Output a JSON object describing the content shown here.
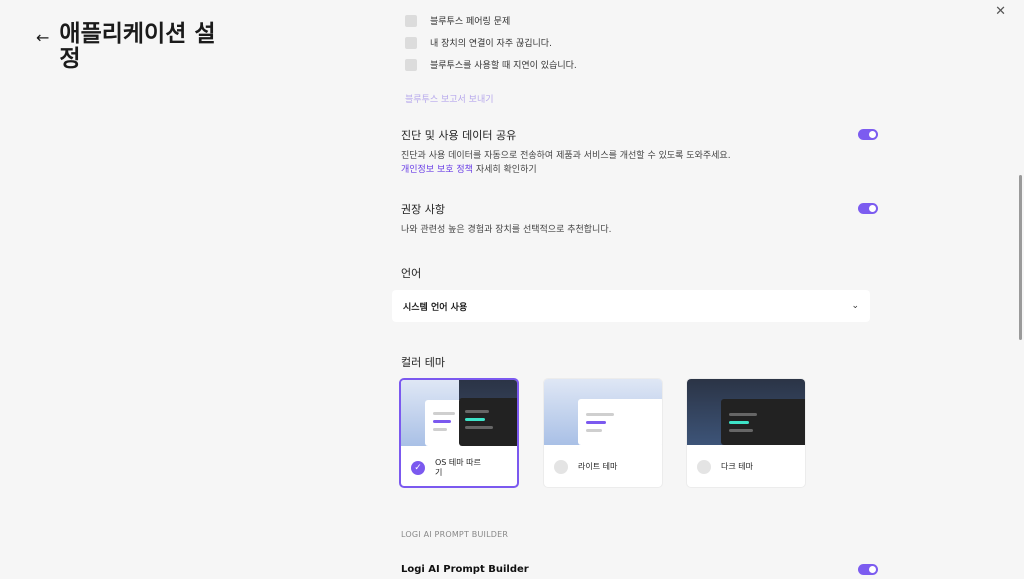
{
  "window": {
    "close_glyph": "✕"
  },
  "header": {
    "back_glyph": "←",
    "title": "애플리케이션 설정"
  },
  "bluetooth_issues": [
    {
      "label": "블루투스 페어링 문제"
    },
    {
      "label": "내 장치의 연결이 자주 끊깁니다."
    },
    {
      "label": "블루투스를 사용할 때 지연이 있습니다."
    }
  ],
  "report_link": "블루투스 보고서 보내기",
  "diagnostics": {
    "title": "진단 및 사용 데이터 공유",
    "description": "진단과 사용 데이터를 자동으로 전송하여 제품과 서비스를 개선할 수 있도록 도와주세요.",
    "privacy_link": "개인정보 보호 정책",
    "privacy_suffix": " 자세히 확인하기",
    "enabled": true
  },
  "recommendations": {
    "title": "권장 사항",
    "description": "나와 관련성 높은 경험과 장치를 선택적으로 추천합니다.",
    "enabled": true
  },
  "language": {
    "label": "언어",
    "selected": "시스템 언어 사용",
    "chevron": "⌄"
  },
  "theme": {
    "label": "컬러 테마",
    "options": [
      {
        "name": "OS 테마 따르기",
        "selected": true,
        "check": "✓"
      },
      {
        "name": "라이트 테마",
        "selected": false
      },
      {
        "name": "다크 테마",
        "selected": false
      }
    ]
  },
  "prompt_builder": {
    "section": "LOGI AI PROMPT BUILDER",
    "title": "Logi AI Prompt Builder",
    "enabled": true
  },
  "colors": {
    "accent": "#7b59ef",
    "link": "#6a3fe6"
  }
}
